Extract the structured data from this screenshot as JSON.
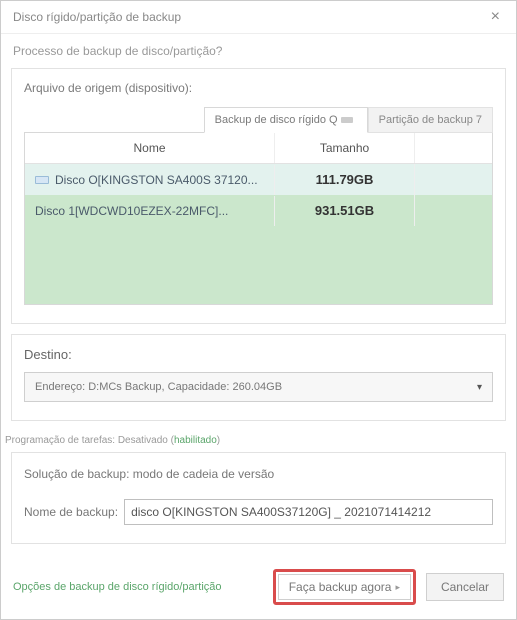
{
  "window": {
    "title": "Disco rígido/partição de backup",
    "subtitle": "Processo de backup de disco/partição?"
  },
  "source": {
    "label": "Arquivo de origem (dispositivo):",
    "tabs": {
      "active": "Backup de disco rígido Q",
      "inactive": "Partição de backup 7"
    },
    "columns": {
      "name": "Nome",
      "size": "Tamanho"
    },
    "rows": [
      {
        "name": "Disco O[KINGSTON SA400S 37120...",
        "size": "111.79GB",
        "selected": true,
        "icon": true
      },
      {
        "name": "Disco 1[WDCWD10EZEX-22MFC]...",
        "size": "931.51GB",
        "selected": false,
        "icon": false
      }
    ]
  },
  "destination": {
    "label": "Destino:",
    "value": "Endereço: D:MCs Backup, Capacidade: 260.04GB"
  },
  "schedule": {
    "prefix": "Programação de tarefas: Desativado (",
    "link": "habilitado",
    "suffix": ")"
  },
  "solution": {
    "mode_line": "Solução de backup: modo de cadeia de versão",
    "name_label": "Nome de backup:",
    "name_value": "disco O[KINGSTON SA400S37120G] _ 2021071414212"
  },
  "footer": {
    "options_link": "Opções de backup de disco rígido/partição",
    "primary": "Faça backup agora",
    "cancel": "Cancelar"
  }
}
